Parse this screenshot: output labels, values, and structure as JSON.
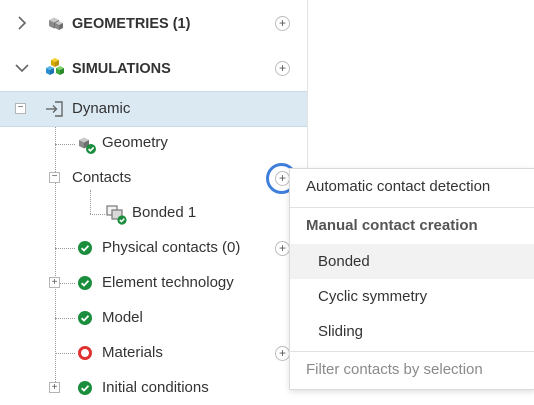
{
  "tree": {
    "geometries": {
      "label": "GEOMETRIES (1)",
      "add": "+"
    },
    "simulations": {
      "label": "SIMULATIONS",
      "add": "+"
    },
    "dynamic": {
      "label": "Dynamic",
      "toggle": "−"
    },
    "geometry": {
      "label": "Geometry"
    },
    "contacts": {
      "label": "Contacts",
      "toggle": "−",
      "add": "+"
    },
    "bonded1": {
      "label": "Bonded 1"
    },
    "physical_contacts": {
      "label": "Physical contacts (0)",
      "add": "+"
    },
    "element_technology": {
      "label": "Element technology",
      "toggle": "+"
    },
    "model": {
      "label": "Model"
    },
    "materials": {
      "label": "Materials",
      "add": "+"
    },
    "initial_conditions": {
      "label": "Initial conditions",
      "toggle": "+"
    }
  },
  "menu": {
    "automatic": "Automatic contact detection",
    "manual_header": "Manual contact creation",
    "bonded": "Bonded",
    "cyclic": "Cyclic symmetry",
    "sliding": "Sliding",
    "filter": "Filter contacts by selection"
  },
  "colors": {
    "selected_row": "#dbe9f3",
    "check_green": "#1b8e3e",
    "error_red": "#e03131",
    "focus_ring": "#3f7fdc"
  },
  "icons": [
    "chevron-right-icon",
    "chevron-down-icon",
    "cube-icon",
    "simulation-cubes-icon",
    "input-arrow-icon",
    "geometry-cube-icon",
    "check-icon",
    "bonded-contact-icon",
    "error-ring-icon",
    "plus-icon"
  ]
}
